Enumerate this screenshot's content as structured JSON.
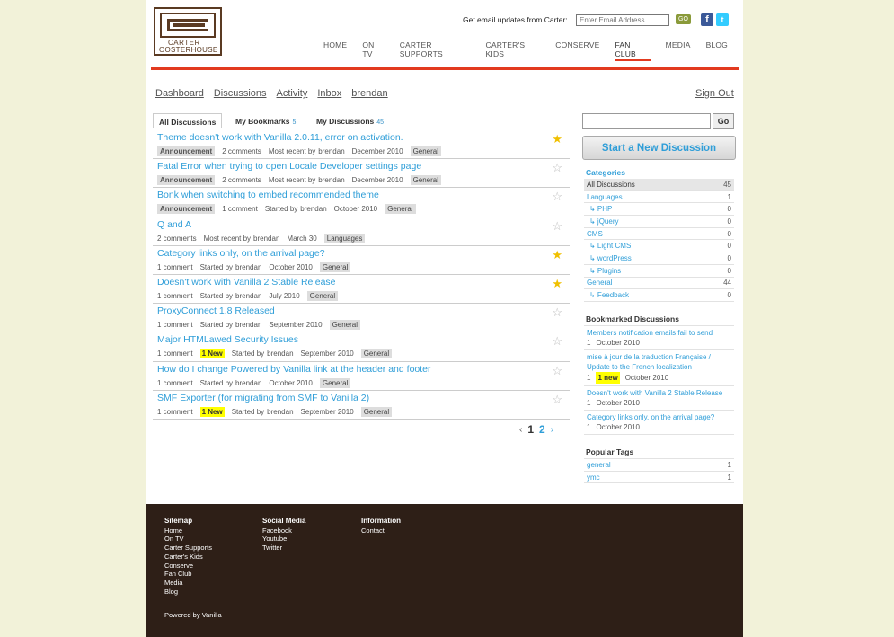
{
  "header": {
    "logo_line1": "CARTER",
    "logo_line2": "OOSTERHOUSE",
    "email_label": "Get email updates from Carter:",
    "email_placeholder": "Enter Email Address",
    "email_go": "GO",
    "nav": [
      "HOME",
      "ON TV",
      "CARTER SUPPORTS",
      "CARTER'S KIDS",
      "CONSERVE",
      "FAN CLUB",
      "MEDIA",
      "BLOG"
    ],
    "nav_active": "FAN CLUB",
    "accent_color": "#e23a1f"
  },
  "subnav": {
    "items": [
      "Dashboard",
      "Discussions",
      "Activity",
      "Inbox",
      "brendan"
    ],
    "signout": "Sign Out"
  },
  "tabs": {
    "all": "All Discussions",
    "bookmarks": "My Bookmarks",
    "bookmarks_count": "5",
    "mine": "My Discussions",
    "mine_count": "45"
  },
  "discussions": [
    {
      "title": "Theme doesn't work with Vanilla 2.0.11, error on activation.",
      "announcement": "Announcement",
      "comments": "2 comments",
      "who": "Most recent by",
      "user": "brendan",
      "date": "December 2010",
      "category": "General",
      "starred": true
    },
    {
      "title": "Fatal Error when trying to open Locale Developer settings page",
      "announcement": "Announcement",
      "comments": "2 comments",
      "who": "Most recent by",
      "user": "brendan",
      "date": "December 2010",
      "category": "General",
      "starred": false
    },
    {
      "title": "Bonk when switching to embed recommended theme",
      "announcement": "Announcement",
      "comments": "1 comment",
      "who": "Started by",
      "user": "brendan",
      "date": "October 2010",
      "category": "General",
      "starred": false
    },
    {
      "title": "Q and A",
      "comments": "2 comments",
      "who": "Most recent by",
      "user": "brendan",
      "date": "March 30",
      "category": "Languages",
      "starred": false
    },
    {
      "title": "Category links only, on the arrival page?",
      "comments": "1 comment",
      "who": "Started by",
      "user": "brendan",
      "date": "October 2010",
      "category": "General",
      "starred": true
    },
    {
      "title": "Doesn't work with Vanilla 2 Stable Release",
      "comments": "1 comment",
      "who": "Started by",
      "user": "brendan",
      "date": "July 2010",
      "category": "General",
      "starred": true
    },
    {
      "title": "ProxyConnect 1.8 Released",
      "comments": "1 comment",
      "who": "Started by",
      "user": "brendan",
      "date": "September 2010",
      "category": "General",
      "starred": false
    },
    {
      "title": "Major HTMLawed Security Issues",
      "comments": "1 comment",
      "new": "1 New",
      "who": "Started by",
      "user": "brendan",
      "date": "September 2010",
      "category": "General",
      "starred": false
    },
    {
      "title": "How do I change Powered by Vanilla link at the header and footer",
      "comments": "1 comment",
      "who": "Started by",
      "user": "brendan",
      "date": "October 2010",
      "category": "General",
      "starred": false
    },
    {
      "title": "SMF Exporter (for migrating from SMF to Vanilla 2)",
      "comments": "1 comment",
      "new": "1 New",
      "who": "Started by",
      "user": "brendan",
      "date": "September 2010",
      "category": "General",
      "starred": false
    }
  ],
  "pager": {
    "prev": "‹",
    "current": "1",
    "next_page": "2",
    "next": "›"
  },
  "sidebar": {
    "search_go": "Go",
    "start_button": "Start a New Discussion",
    "categories_title": "Categories",
    "categories": [
      {
        "name": "All Discussions",
        "count": "45"
      },
      {
        "name": "Languages",
        "count": "1"
      },
      {
        "name": "↳ PHP",
        "count": "0"
      },
      {
        "name": "↳ jQuery",
        "count": "0"
      },
      {
        "name": "CMS",
        "count": "0"
      },
      {
        "name": "↳ Light CMS",
        "count": "0"
      },
      {
        "name": "↳ wordPress",
        "count": "0"
      },
      {
        "name": "↳ Plugins",
        "count": "0"
      },
      {
        "name": "General",
        "count": "44"
      },
      {
        "name": "↳ Feedback",
        "count": "0"
      }
    ],
    "bookmarked_title": "Bookmarked Discussions",
    "bookmarked": [
      {
        "title": "Members notification emails fail to send",
        "count": "1",
        "date": "October 2010"
      },
      {
        "title": "mise à jour de la traduction Française / Update to the French localization",
        "count": "1",
        "new": "1 new",
        "date": "October 2010"
      },
      {
        "title": "Doesn't work with Vanilla 2 Stable Release",
        "count": "1",
        "date": "October 2010"
      },
      {
        "title": "Category links only, on the arrival page?",
        "count": "1",
        "date": "October 2010"
      }
    ],
    "tags_title": "Popular Tags",
    "tags": [
      {
        "name": "general",
        "count": "1"
      },
      {
        "name": "ymc",
        "count": "1"
      }
    ]
  },
  "footer": {
    "sitemap_title": "Sitemap",
    "sitemap": [
      "Home",
      "On TV",
      "Carter Supports",
      "Carter's Kids",
      "Conserve",
      "Fan Club",
      "Media",
      "Blog"
    ],
    "social_title": "Social Media",
    "social": [
      "Facebook",
      "Youtube",
      "Twitter"
    ],
    "info_title": "Information",
    "info": [
      "Contact"
    ],
    "powered": "Powered by Vanilla"
  }
}
